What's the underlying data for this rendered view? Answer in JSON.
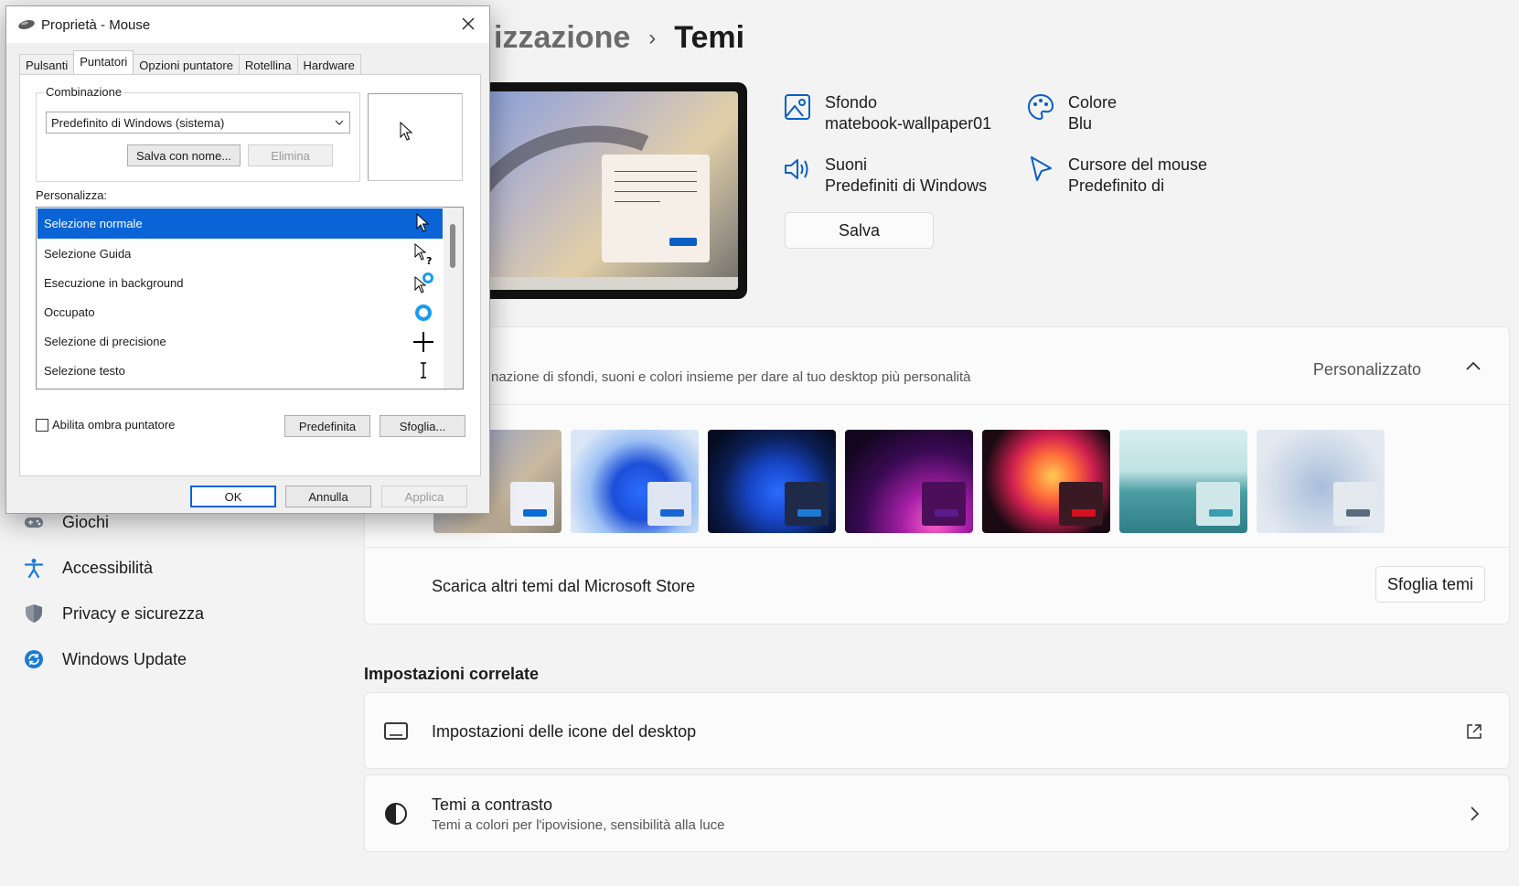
{
  "settings": {
    "breadcrumb_parent": "izzazione",
    "breadcrumb_sep": "›",
    "breadcrumb_current": "Temi",
    "props": {
      "sfondo_title": "Sfondo",
      "sfondo_value": "matebook-wallpaper01",
      "colore_title": "Colore",
      "colore_value": "Blu",
      "suoni_title": "Suoni",
      "suoni_value": "Predefiniti di Windows",
      "cursore_title": "Cursore del mouse",
      "cursore_value": "Predefinito di"
    },
    "save_label": "Salva",
    "themes_desc": "nazione di sfondi, suoni e colori insieme per dare al tuo desktop più personalità",
    "current_theme": "Personalizzato",
    "store_label": "Scarica altri temi dal Microsoft Store",
    "store_button": "Sfoglia temi",
    "related_title": "Impostazioni correlate",
    "related": {
      "desktop_icons": "Impostazioni delle icone del desktop",
      "contrast_title": "Temi a contrasto",
      "contrast_sub": "Temi a colori per l'ipovisione, sensibilità alla luce"
    },
    "nav": {
      "giochi": "Giochi",
      "accessibilita": "Accessibilità",
      "privacy": "Privacy e sicurezza",
      "update": "Windows Update"
    },
    "accent_color": "#0a5fc4"
  },
  "dialog": {
    "title": "Proprietà - Mouse",
    "tabs": {
      "pulsanti": "Pulsanti",
      "puntatori": "Puntatori",
      "opzioni": "Opzioni puntatore",
      "rotellina": "Rotellina",
      "hardware": "Hardware"
    },
    "scheme_label": "Combinazione",
    "scheme_value": "Predefinito di Windows (sistema)",
    "save_as": "Salva con nome...",
    "delete": "Elimina",
    "customize_label": "Personalizza:",
    "cursors": {
      "normal": "Selezione normale",
      "help": "Selezione Guida",
      "background": "Esecuzione in background",
      "busy": "Occupato",
      "precision": "Selezione di precisione",
      "text": "Selezione testo"
    },
    "shadow_label": "Abilita ombra puntatore",
    "default_btn": "Predefinita",
    "browse_btn": "Sfoglia...",
    "ok": "OK",
    "cancel": "Annulla",
    "apply": "Applica",
    "selection_color": "#0a64d6"
  }
}
